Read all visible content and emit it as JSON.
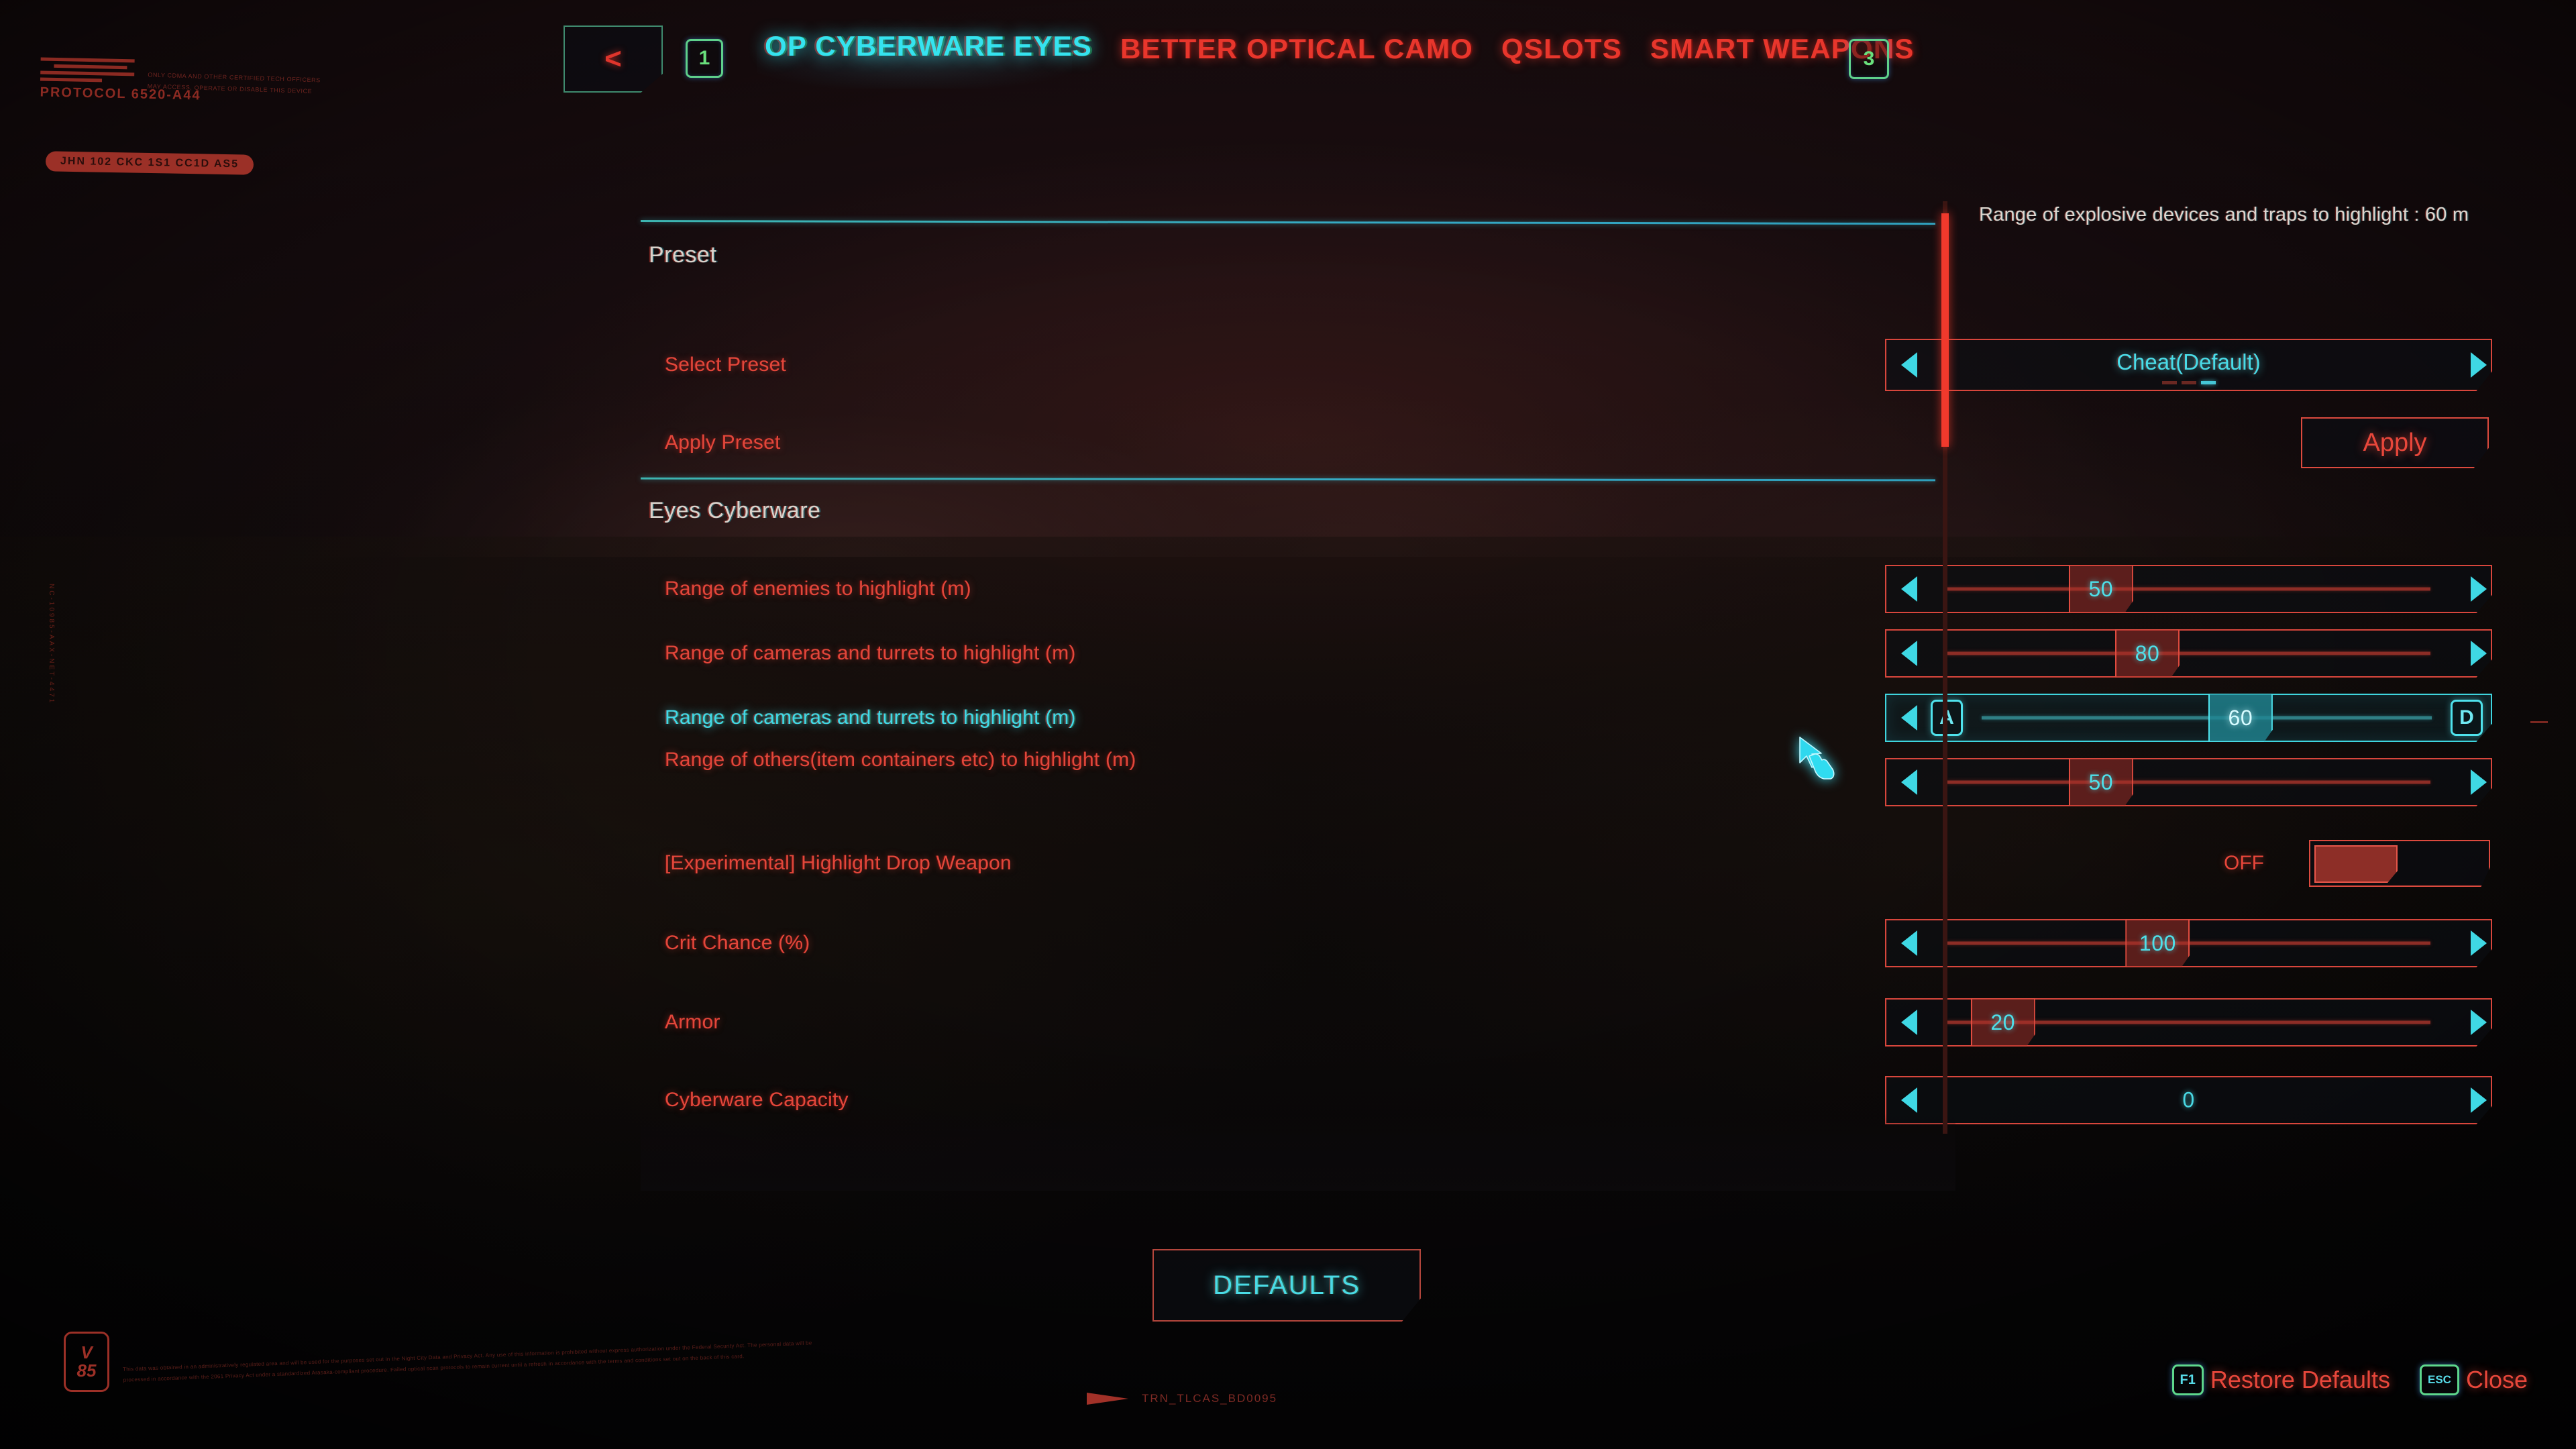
{
  "nav": {
    "back_label": "<",
    "page_prev": "1",
    "page_next": "3",
    "tabs": [
      {
        "label": "OP CYBERWARE EYES",
        "active": true
      },
      {
        "label": "BETTER OPTICAL CAMO",
        "active": false
      },
      {
        "label": "QSLOTS",
        "active": false
      },
      {
        "label": "SMART WEAPONS",
        "active": false
      }
    ]
  },
  "panel": {
    "sections": [
      {
        "title": "Preset"
      },
      {
        "title": "Eyes Cyberware"
      }
    ],
    "preset": {
      "select_label": "Select Preset",
      "select_value": "Cheat(Default)",
      "apply_label": "Apply Preset",
      "apply_button": "Apply"
    },
    "settings": [
      {
        "label": "Range of enemies to highlight (m)",
        "value": "50",
        "fill_pct": 33,
        "focused": false
      },
      {
        "label": "Range of cameras and turrets to highlight (m)",
        "value": "80",
        "fill_pct": 42,
        "focused": false
      },
      {
        "label": "Range of cameras and turrets to highlight (m)",
        "value": "60",
        "fill_pct": 57,
        "focused": true,
        "key_left": "A",
        "key_right": "D"
      },
      {
        "label": "Range of others(item containers etc) to highlight (m)",
        "value": "50",
        "fill_pct": 33,
        "focused": false
      },
      {
        "label": "[Experimental] Highlight Drop Weapon",
        "value": "OFF",
        "type": "toggle",
        "focused": false
      },
      {
        "label": "Crit Chance (%)",
        "value": "100",
        "fill_pct": 44,
        "focused": false
      },
      {
        "label": "Armor",
        "value": "20",
        "fill_pct": 21,
        "focused": false
      },
      {
        "label": "Cyberware Capacity",
        "value": "0",
        "fill_pct": 0,
        "focused": false
      }
    ]
  },
  "tooltip": {
    "text": "Range of explosive devices and traps to highlight : 60 m"
  },
  "bottom": {
    "defaults_label": "DEFAULTS",
    "hints": [
      {
        "key": "F1",
        "label": "Restore Defaults"
      },
      {
        "key": "ESC",
        "label": "Close"
      }
    ]
  },
  "hud": {
    "protocol": "PROTOCOL\n6520-A44",
    "micro_line_1": "ONLY CDMA AND OTHER CERTIFIED TECH OFFICERS",
    "micro_line_2": "MAY ACCESS, OPERATE OR DISABLE THIS DEVICE",
    "plate": "JHN 102 CKC 1S1 CC1D AS5",
    "vertical_strip": "NC-10985-AAX-NET-4471",
    "badge_letter": "V",
    "badge_number": "85",
    "legal_text": "This data was obtained in an administratively regulated area and will be used for the purposes set out in the Night City Data and Privacy Act. Any use of this information is prohibited without express authorization under the Federal Security Act. The personal data will be processed in accordance with the 2061 Privacy Act under a standardized Arasaka-compliant procedure. Failed optical scan protocols to remain current until a refresh in accordance with the terms and conditions set out on the back of this card.",
    "bottom_code": "TRN_TLCAS_BD0095"
  },
  "colors": {
    "accent_red": "#e2473b",
    "accent_cyan": "#3fd5de",
    "divider_teal": "#3db4b0",
    "panel_bg": "#0d0a0c",
    "scrollbar": "#f0392c",
    "keycap_green": "#5fd08a"
  }
}
